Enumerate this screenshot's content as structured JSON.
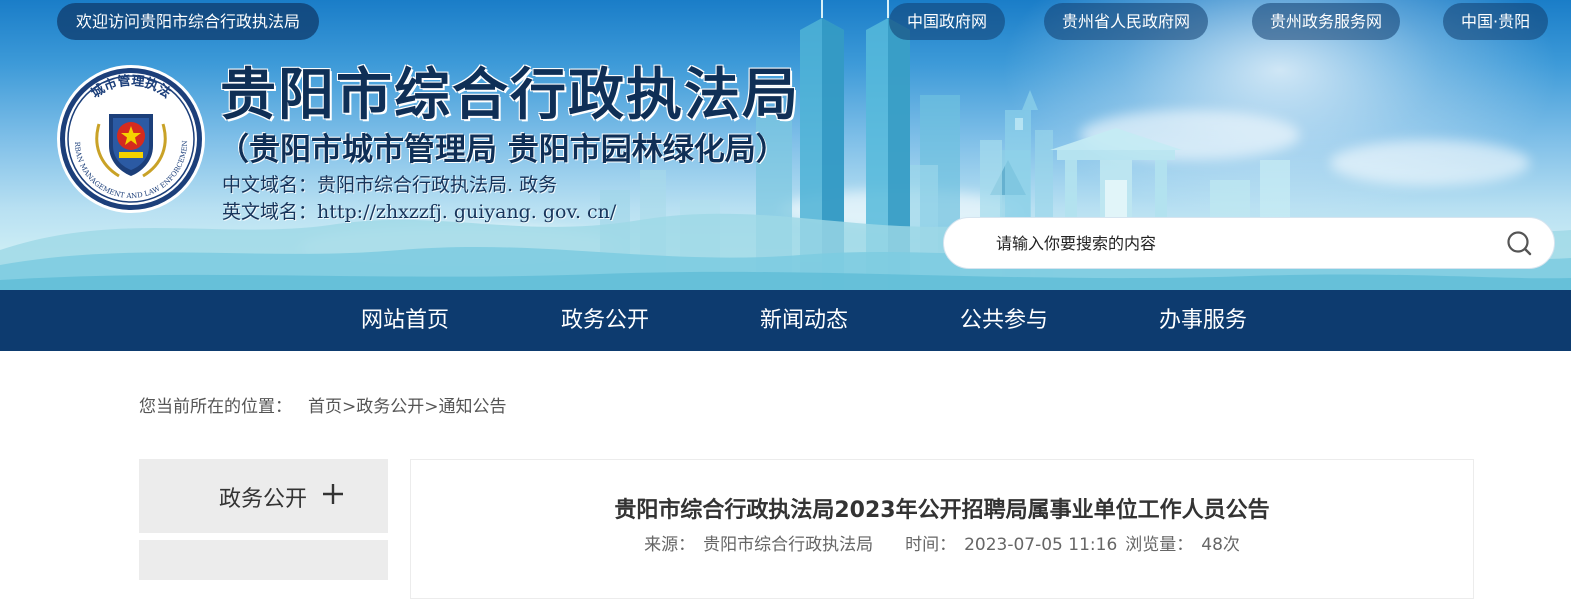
{
  "header": {
    "welcome": "欢迎访问贵阳市综合行政执法局",
    "top_links": [
      "中国政府网",
      "贵州省人民政府网",
      "贵州政务服务网",
      "中国·贵阳"
    ],
    "title": "贵阳市综合行政执法局",
    "subtitle": "（贵阳市城市管理局  贵阳市园林绿化局）",
    "cn_domain": "中文域名：贵阳市综合行政执法局. 政务",
    "en_domain": "英文域名：http://zhxzzfj. guiyang. gov. cn/",
    "emblem": {
      "icon": "city-management-emblem-icon",
      "ring_top_text": "城市管理执法",
      "ring_bottom_text": "URBAN MANAGEMENT AND LAW ENFORCEMENT"
    }
  },
  "search": {
    "placeholder": "请输入你要搜索的内容",
    "icon": "search-icon"
  },
  "nav": {
    "items": [
      "网站首页",
      "政务公开",
      "新闻动态",
      "公共参与",
      "办事服务"
    ]
  },
  "breadcrumb": {
    "prefix": "您当前所在的位置：",
    "path": [
      "首页",
      "政务公开",
      "通知公告"
    ],
    "separator": ">"
  },
  "sidebar": {
    "heading": "政务公开",
    "expand_icon": "plus-icon"
  },
  "article": {
    "title": "贵阳市综合行政执法局2023年公开招聘局属事业单位工作人员公告",
    "source_label": "来源：",
    "source": "贵阳市综合行政执法局",
    "time_label": "时间：",
    "time": "2023-07-05 11:16",
    "views_label": "浏览量：",
    "views": "48次"
  },
  "colors": {
    "nav_bg": "#0d3b6f",
    "title_text": "#0f2f56",
    "sidebar_bg": "#ececec",
    "pill_bg": "#103e70"
  }
}
